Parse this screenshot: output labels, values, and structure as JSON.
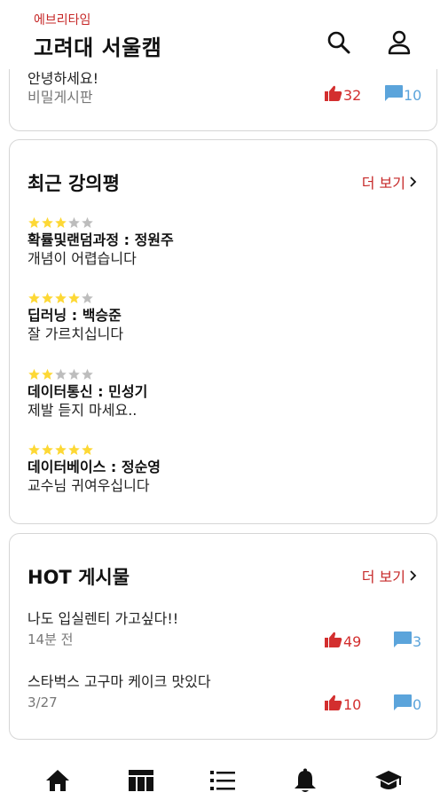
{
  "header": {
    "app_name": "에브리타임",
    "school": "고려대 서울캠",
    "icons": [
      "search-icon",
      "user-icon"
    ]
  },
  "top_card": {
    "partial_title": "안녕하세요!",
    "board": "비밀게시판",
    "likes": "32",
    "comments": "10"
  },
  "reviews": {
    "title": "최근 강의평",
    "more": "더 보기",
    "items": [
      {
        "rating": 3,
        "max": 5,
        "course": "확률및랜덤과정 : 정원주",
        "text": "개념이 어렵습니다"
      },
      {
        "rating": 4,
        "max": 5,
        "course": "딥러닝 : 백승준",
        "text": "잘 가르치십니다"
      },
      {
        "rating": 2,
        "max": 5,
        "course": "데이터통신 : 민성기",
        "text": "제발 듣지 마세요.."
      },
      {
        "rating": 5,
        "max": 5,
        "course": "데이터베이스 : 정순영",
        "text": "교수님 귀여우십니다"
      }
    ]
  },
  "hot": {
    "title": "HOT 게시물",
    "more": "더 보기",
    "posts": [
      {
        "title": "나도 입실렌티 가고싶다!!",
        "time": "14분 전",
        "likes": "49",
        "comments": "3"
      },
      {
        "title": "스타벅스 고구마 케이크 맛있다",
        "time": "3/27",
        "likes": "10",
        "comments": "0"
      }
    ]
  },
  "nav": {
    "icons": [
      "home-icon",
      "timetable-icon",
      "board-list-icon",
      "notification-bell-icon",
      "graduation-cap-icon"
    ]
  },
  "colors": {
    "accent": "#c62828",
    "like": "#d32f2f",
    "comment": "#5ba4db",
    "star_on": "#fdd835",
    "star_off": "#bdbdbd"
  }
}
